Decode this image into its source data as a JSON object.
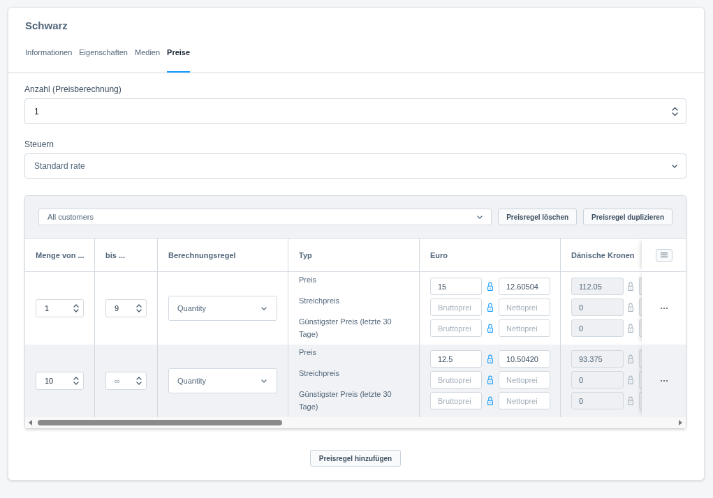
{
  "card": {
    "title": "Schwarz"
  },
  "tabs": [
    {
      "label": "Informationen",
      "selected": false
    },
    {
      "label": "Eigenschaften",
      "selected": false
    },
    {
      "label": "Medien",
      "selected": false
    },
    {
      "label": "Preise",
      "selected": true
    }
  ],
  "fields": [
    {
      "kind": "number",
      "label": "Anzahl (Preisberechnung)",
      "value": "1"
    },
    {
      "kind": "select",
      "label": "Steuern",
      "value": "Standard rate"
    }
  ],
  "price_rules": {
    "customer_rule": {
      "value": "All customers"
    },
    "buttons": [
      "Preisregel löschen",
      "Preisregel duplizieren"
    ],
    "table": {
      "columns": [
        "Menge von ...",
        "bis ...",
        "Berechnungsregel",
        "Typ",
        "Euro",
        "Dänische Kronen"
      ],
      "rows": [
        {
          "highlighted": false,
          "quantity_from": {
            "value": "1"
          },
          "quantity_to": {
            "value": "9"
          },
          "calculation_rule": "Quantity",
          "price_types": [
            "Preis",
            "Streichpreis",
            "Günstigster Preis (letzte 30 Tage)"
          ],
          "currencies": [
            {
              "disabled": false,
              "prices": [
                {
                  "gross": {
                    "value": "15"
                  },
                  "net": {
                    "value": "12.60504"
                  }
                },
                {
                  "gross": {
                    "placeholder": "Bruttoprei"
                  },
                  "net": {
                    "placeholder": "Nettoprei"
                  }
                },
                {
                  "gross": {
                    "placeholder": "Bruttoprei"
                  },
                  "net": {
                    "placeholder": "Nettoprei"
                  }
                }
              ]
            },
            {
              "disabled": true,
              "prices": [
                {
                  "gross": {
                    "value": "112.05"
                  }
                },
                {
                  "gross": {
                    "value": "0"
                  }
                },
                {
                  "gross": {
                    "value": "0"
                  }
                }
              ]
            }
          ]
        },
        {
          "highlighted": true,
          "quantity_from": {
            "value": "10"
          },
          "quantity_to": {
            "placeholder": "∞"
          },
          "calculation_rule": "Quantity",
          "price_types": [
            "Preis",
            "Streichpreis",
            "Günstigster Preis (letzte 30 Tage)"
          ],
          "currencies": [
            {
              "disabled": false,
              "prices": [
                {
                  "gross": {
                    "value": "12.5"
                  },
                  "net": {
                    "value": "10.50420"
                  }
                },
                {
                  "gross": {
                    "placeholder": "Bruttoprei"
                  },
                  "net": {
                    "placeholder": "Nettoprei"
                  }
                },
                {
                  "gross": {
                    "placeholder": "Bruttoprei"
                  },
                  "net": {
                    "placeholder": "Nettoprei"
                  }
                }
              ]
            },
            {
              "disabled": true,
              "prices": [
                {
                  "gross": {
                    "value": "93.375"
                  }
                },
                {
                  "gross": {
                    "value": "0"
                  }
                },
                {
                  "gross": {
                    "value": "0"
                  }
                }
              ]
            }
          ]
        }
      ]
    }
  },
  "add_button": "Preisregel hinzufügen"
}
